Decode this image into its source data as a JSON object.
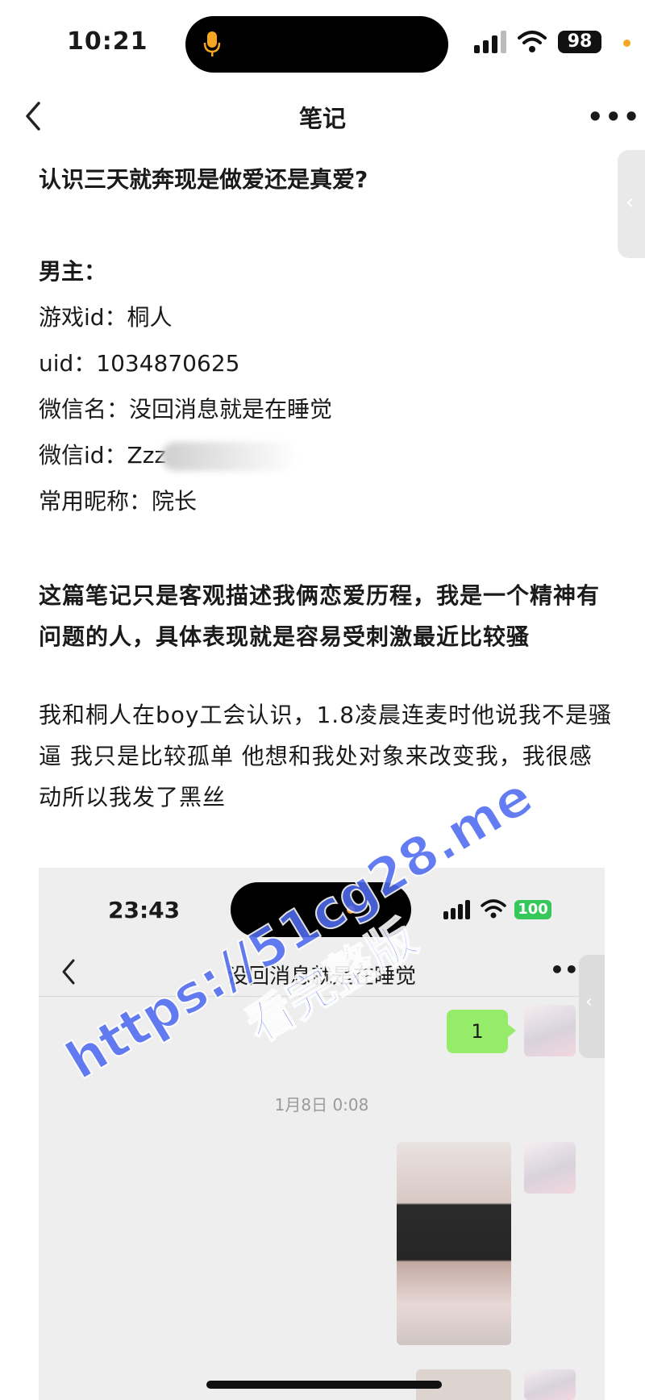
{
  "status_bar": {
    "time": "10:21",
    "battery": "98"
  },
  "nav": {
    "title": "笔记"
  },
  "article": {
    "title": "认识三天就奔现是做爱还是真爱?",
    "male_heading": "男主：",
    "info": [
      "游戏id：桐人",
      "uid：1034870625",
      "微信名：没回消息就是在睡觉",
      "微信id：Zzz",
      "常用昵称：院长"
    ],
    "intro": "这篇笔记只是客观描述我俩恋爱历程，我是一个精神有问题的人，具体表现就是容易受刺激最近比较骚",
    "story": "我和桐人在boy工会认识，1.8凌晨连麦时他说我不是骚逼 我只是比较孤单 他想和我处对象来改变我，我很感动所以我发了黑丝"
  },
  "screenshot": {
    "time": "23:43",
    "battery": "100",
    "chat_title": "没回消息就是在睡觉",
    "bubble_text": "1",
    "timestamp": "1月8日 0:08"
  },
  "watermark": {
    "line1": "https://51cg28.me",
    "line2": "看完整版"
  }
}
